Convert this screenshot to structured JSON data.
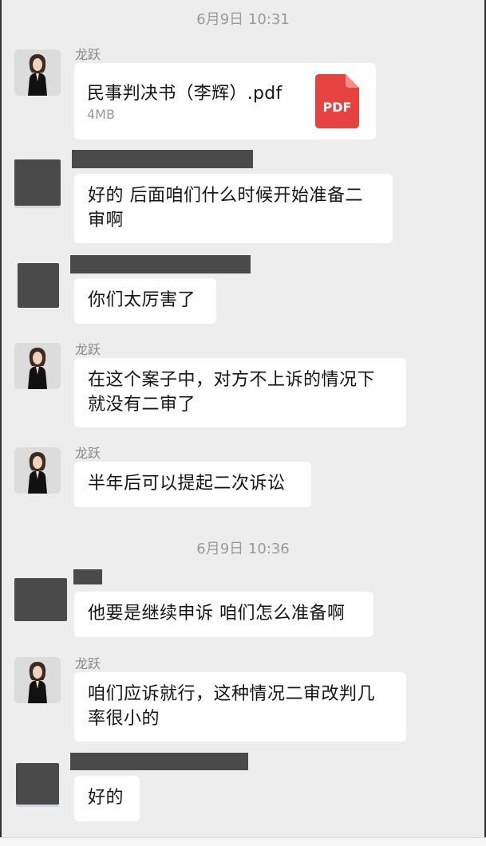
{
  "timestamps": [
    "6月9日 10:31",
    "6月9日 10:36"
  ],
  "sender_name": "龙跃",
  "file": {
    "name": "民事判决书（李辉）.pdf",
    "size": "4MB",
    "type_label": "PDF"
  },
  "messages": [
    "好的 后面咱们什么时候开始准备二审啊",
    "你们太厉害了",
    "在这个案子中，对方不上诉的情况下就没有二审了",
    "半年后可以提起二次诉讼",
    "他要是继续申诉 咱们怎么准备啊",
    "咱们应诉就行，这种情况二审改判几率很小的",
    "好的"
  ],
  "colors": {
    "background": "#ededed",
    "bubble": "#ffffff",
    "pdf_red": "#e64340",
    "redaction": "#4a4a4a"
  }
}
